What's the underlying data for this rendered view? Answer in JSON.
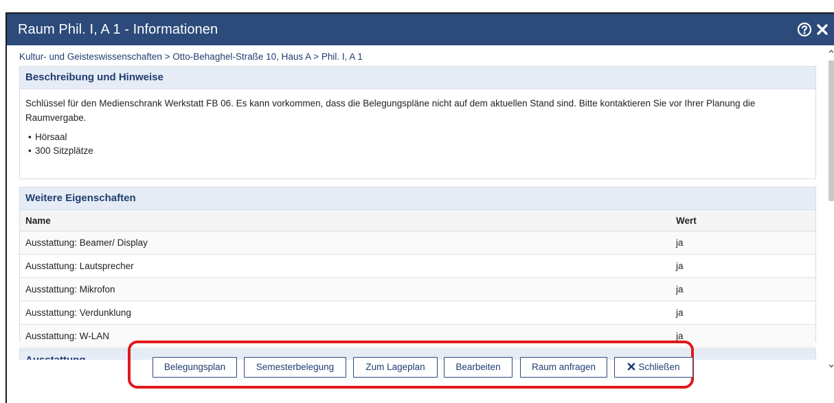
{
  "dialog": {
    "title": "Raum Phil. I, A 1 - Informationen",
    "help_icon": "help-icon",
    "close_icon": "close-icon"
  },
  "breadcrumb": {
    "items": [
      "Kultur- und Geisteswissenschaften",
      "Otto-Behaghel-Straße 10, Haus A",
      "Phil. I, A 1"
    ],
    "separator": ">"
  },
  "description": {
    "heading": "Beschreibung und Hinweise",
    "text": "Schlüssel für den Medienschrank Werkstatt FB 06. Es kann vorkommen, dass die Belegungspläne nicht auf dem aktuellen Stand sind. Bitte kontaktieren Sie vor Ihrer Planung die Raumvergabe.",
    "bullets": [
      "Hörsaal",
      "300 Sitzplätze"
    ]
  },
  "properties": {
    "heading": "Weitere Eigenschaften",
    "columns": [
      "Name",
      "Wert"
    ],
    "rows": [
      {
        "name": "Ausstattung: Beamer/ Display",
        "value": "ja"
      },
      {
        "name": "Ausstattung: Lautsprecher",
        "value": "ja"
      },
      {
        "name": "Ausstattung: Mikrofon",
        "value": "ja"
      },
      {
        "name": "Ausstattung: Verdunklung",
        "value": "ja"
      },
      {
        "name": "Ausstattung: W-LAN",
        "value": "ja"
      }
    ]
  },
  "equipment": {
    "heading": "Ausstattung"
  },
  "buttons": {
    "belegungsplan": "Belegungsplan",
    "semesterbelegung": "Semesterbelegung",
    "lageplan": "Zum Lageplan",
    "bearbeiten": "Bearbeiten",
    "anfragen": "Raum anfragen",
    "schliessen": "Schließen"
  },
  "colors": {
    "titlebar": "#2c4a7a",
    "panel_header": "#e6ecf5",
    "link_text": "#1f3d70",
    "highlight": "#e0181b"
  }
}
